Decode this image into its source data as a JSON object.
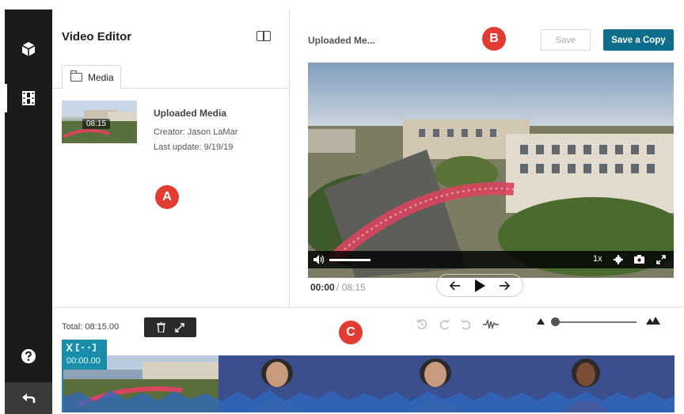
{
  "app": {
    "panel_title": "Video Editor",
    "tab_label": "Media"
  },
  "media": {
    "duration": "08:15",
    "name": "Uploaded Media",
    "creator": "Creator: Jason LaMar",
    "last_update": "Last update: 9/19/19"
  },
  "preview": {
    "title": "Uploaded Me...",
    "save_label": "Save",
    "save_copy_label": "Save a Copy",
    "speed": "1x",
    "current_time": "00:00",
    "separator": "/",
    "total_time": "08:15"
  },
  "timeline": {
    "total": "Total: 08:15.00",
    "playhead_time": "00:00.00"
  },
  "markers": {
    "a": "A",
    "b": "B",
    "c": "C"
  },
  "colors": {
    "accent": "#0f6d8c",
    "marker": "#e23b32",
    "rail": "#1b1b1b",
    "track": "#3d5497",
    "playhead": "#1a8ea8"
  }
}
